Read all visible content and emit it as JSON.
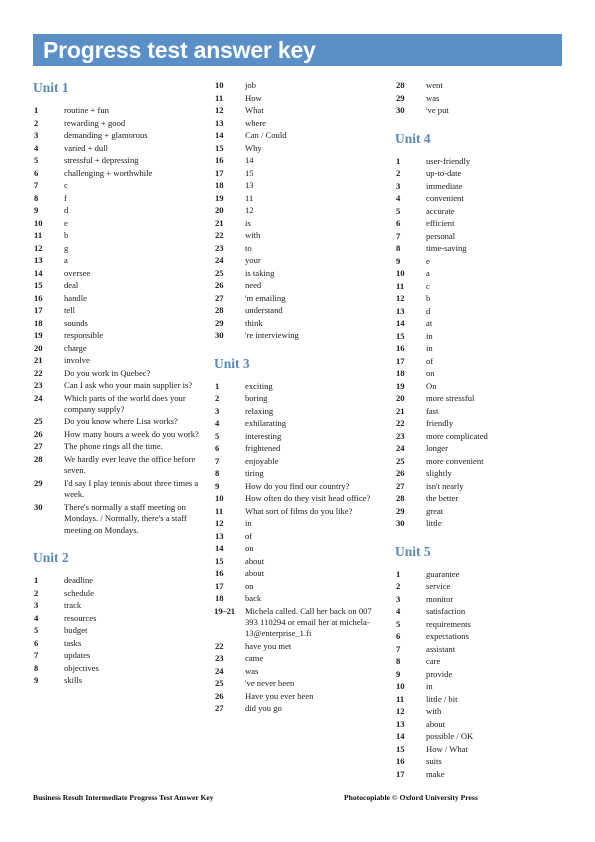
{
  "header": {
    "title": "Progress test answer key",
    "bar_color": "#5a8fc7",
    "title_color": "#ffffff"
  },
  "unit_heading_color": "#5b89b5",
  "columns": [
    {
      "blocks": [
        {
          "type": "unit",
          "heading": "Unit 1",
          "items": [
            {
              "num": "1",
              "text": "routine + fun"
            },
            {
              "num": "2",
              "text": "rewarding + good"
            },
            {
              "num": "3",
              "text": "demanding + glamorous"
            },
            {
              "num": "4",
              "text": "varied + dull"
            },
            {
              "num": "5",
              "text": "stressful + depressing"
            },
            {
              "num": "6",
              "text": "challenging + worthwhile"
            },
            {
              "num": "7",
              "text": "c"
            },
            {
              "num": "8",
              "text": "f"
            },
            {
              "num": "9",
              "text": "d"
            },
            {
              "num": "10",
              "text": "e"
            },
            {
              "num": "11",
              "text": "b"
            },
            {
              "num": "12",
              "text": "g"
            },
            {
              "num": "13",
              "text": "a"
            },
            {
              "num": "14",
              "text": "oversee"
            },
            {
              "num": "15",
              "text": "deal"
            },
            {
              "num": "16",
              "text": "handle"
            },
            {
              "num": "17",
              "text": "tell"
            },
            {
              "num": "18",
              "text": "sounds"
            },
            {
              "num": "19",
              "text": "responsible"
            },
            {
              "num": "20",
              "text": "charge"
            },
            {
              "num": "21",
              "text": "involve"
            },
            {
              "num": "22",
              "text": "Do you work in Quebec?"
            },
            {
              "num": "23",
              "text": "Can I ask who your main supplier is?"
            },
            {
              "num": "24",
              "text": "Which parts of the world does your company supply?"
            },
            {
              "num": "25",
              "text": "Do you know where Lisa works?"
            },
            {
              "num": "26",
              "text": "How many hours a week do you work?"
            },
            {
              "num": "27",
              "text": "The phone rings all the time."
            },
            {
              "num": "28",
              "text": "We hardly ever leave the office before seven."
            },
            {
              "num": "29",
              "text": "I'd say I play tennis about three times a week."
            },
            {
              "num": "30",
              "text": "There's normally a staff meeting on Mondays. / Normally, there's a staff meeting on Mondays."
            }
          ]
        },
        {
          "type": "unit",
          "heading": "Unit 2",
          "items": [
            {
              "num": "1",
              "text": "deadline"
            },
            {
              "num": "2",
              "text": "schedule"
            },
            {
              "num": "3",
              "text": "track"
            },
            {
              "num": "4",
              "text": "resources"
            },
            {
              "num": "5",
              "text": "budget"
            },
            {
              "num": "6",
              "text": "tasks"
            },
            {
              "num": "7",
              "text": "updates"
            },
            {
              "num": "8",
              "text": "objectives"
            },
            {
              "num": "9",
              "text": "skills"
            }
          ]
        }
      ]
    },
    {
      "blocks": [
        {
          "type": "continuation",
          "heading": "",
          "items": [
            {
              "num": "10",
              "text": "job"
            },
            {
              "num": "11",
              "text": "How"
            },
            {
              "num": "12",
              "text": "What"
            },
            {
              "num": "13",
              "text": "where"
            },
            {
              "num": "14",
              "text": "Can / Could"
            },
            {
              "num": "15",
              "text": "Why"
            },
            {
              "num": "16",
              "text": "14"
            },
            {
              "num": "17",
              "text": "15"
            },
            {
              "num": "18",
              "text": "13"
            },
            {
              "num": "19",
              "text": "11"
            },
            {
              "num": "20",
              "text": "12"
            },
            {
              "num": "21",
              "text": "is"
            },
            {
              "num": "22",
              "text": "with"
            },
            {
              "num": "23",
              "text": "to"
            },
            {
              "num": "24",
              "text": "your"
            },
            {
              "num": "25",
              "text": "is taking"
            },
            {
              "num": "26",
              "text": "need"
            },
            {
              "num": "27",
              "text": "'m emailing"
            },
            {
              "num": "28",
              "text": "understand"
            },
            {
              "num": "29",
              "text": "think"
            },
            {
              "num": "30",
              "text": "'re interviewing"
            }
          ]
        },
        {
          "type": "unit",
          "heading": "Unit 3",
          "items": [
            {
              "num": "1",
              "text": "exciting"
            },
            {
              "num": "2",
              "text": "boring"
            },
            {
              "num": "3",
              "text": "relaxing"
            },
            {
              "num": "4",
              "text": "exhilarating"
            },
            {
              "num": "5",
              "text": "interesting"
            },
            {
              "num": "6",
              "text": "frightened"
            },
            {
              "num": "7",
              "text": "enjoyable"
            },
            {
              "num": "8",
              "text": "tiring"
            },
            {
              "num": "9",
              "text": "How do you find our country?"
            },
            {
              "num": "10",
              "text": "How often do they visit head office?"
            },
            {
              "num": "11",
              "text": "What sort of films do you like?"
            },
            {
              "num": "12",
              "text": "in"
            },
            {
              "num": "13",
              "text": "of"
            },
            {
              "num": "14",
              "text": "on"
            },
            {
              "num": "15",
              "text": "about"
            },
            {
              "num": "16",
              "text": "about"
            },
            {
              "num": "17",
              "text": "on"
            },
            {
              "num": "18",
              "text": "back"
            },
            {
              "num": "19–21",
              "text": "Michela called. Call her back on 007 393 110294 or email her at michela-13@enterprise_1.fi"
            },
            {
              "num": "22",
              "text": "have you met"
            },
            {
              "num": "23",
              "text": "came"
            },
            {
              "num": "24",
              "text": "was"
            },
            {
              "num": "25",
              "text": "'ve never been"
            },
            {
              "num": "26",
              "text": "Have you ever been"
            },
            {
              "num": "27",
              "text": "did you go"
            }
          ]
        }
      ]
    },
    {
      "blocks": [
        {
          "type": "continuation",
          "heading": "",
          "items": [
            {
              "num": "28",
              "text": "went"
            },
            {
              "num": "29",
              "text": "was"
            },
            {
              "num": "30",
              "text": "'ve put"
            }
          ]
        },
        {
          "type": "unit",
          "heading": "Unit 4",
          "items": [
            {
              "num": "1",
              "text": "user-friendly"
            },
            {
              "num": "2",
              "text": "up-to-date"
            },
            {
              "num": "3",
              "text": "immediate"
            },
            {
              "num": "4",
              "text": "convenient"
            },
            {
              "num": "5",
              "text": "accurate"
            },
            {
              "num": "6",
              "text": "efficient"
            },
            {
              "num": "7",
              "text": "personal"
            },
            {
              "num": "8",
              "text": "time-saving"
            },
            {
              "num": "9",
              "text": "e"
            },
            {
              "num": "10",
              "text": "a"
            },
            {
              "num": "11",
              "text": "c"
            },
            {
              "num": "12",
              "text": "b"
            },
            {
              "num": "13",
              "text": "d"
            },
            {
              "num": "14",
              "text": "at"
            },
            {
              "num": "15",
              "text": "in"
            },
            {
              "num": "16",
              "text": "in"
            },
            {
              "num": "17",
              "text": "of"
            },
            {
              "num": "18",
              "text": "on"
            },
            {
              "num": "19",
              "text": "On"
            },
            {
              "num": "20",
              "text": "more stressful"
            },
            {
              "num": "21",
              "text": "fast"
            },
            {
              "num": "22",
              "text": "friendly"
            },
            {
              "num": "23",
              "text": "more complicated"
            },
            {
              "num": "24",
              "text": "longer"
            },
            {
              "num": "25",
              "text": "more convenient"
            },
            {
              "num": "26",
              "text": "slightly"
            },
            {
              "num": "27",
              "text": "isn't nearly"
            },
            {
              "num": "28",
              "text": "the better"
            },
            {
              "num": "29",
              "text": "great"
            },
            {
              "num": "30",
              "text": "little"
            }
          ]
        },
        {
          "type": "unit",
          "heading": "Unit 5",
          "items": [
            {
              "num": "1",
              "text": "guarantee"
            },
            {
              "num": "2",
              "text": "service"
            },
            {
              "num": "3",
              "text": "monitor"
            },
            {
              "num": "4",
              "text": "satisfaction"
            },
            {
              "num": "5",
              "text": "requirements"
            },
            {
              "num": "6",
              "text": "expectations"
            },
            {
              "num": "7",
              "text": "assistant"
            },
            {
              "num": "8",
              "text": "care"
            },
            {
              "num": "9",
              "text": "provide"
            },
            {
              "num": "10",
              "text": "in"
            },
            {
              "num": "11",
              "text": "little / bit"
            },
            {
              "num": "12",
              "text": "with"
            },
            {
              "num": "13",
              "text": "about"
            },
            {
              "num": "14",
              "text": "possible / OK"
            },
            {
              "num": "15",
              "text": "How / What"
            },
            {
              "num": "16",
              "text": "suits"
            },
            {
              "num": "17",
              "text": "make"
            }
          ]
        }
      ]
    }
  ],
  "footer": {
    "left": "Business Result Intermediate Progress Test Answer Key",
    "right": "Photocopiable © Oxford University Press"
  }
}
